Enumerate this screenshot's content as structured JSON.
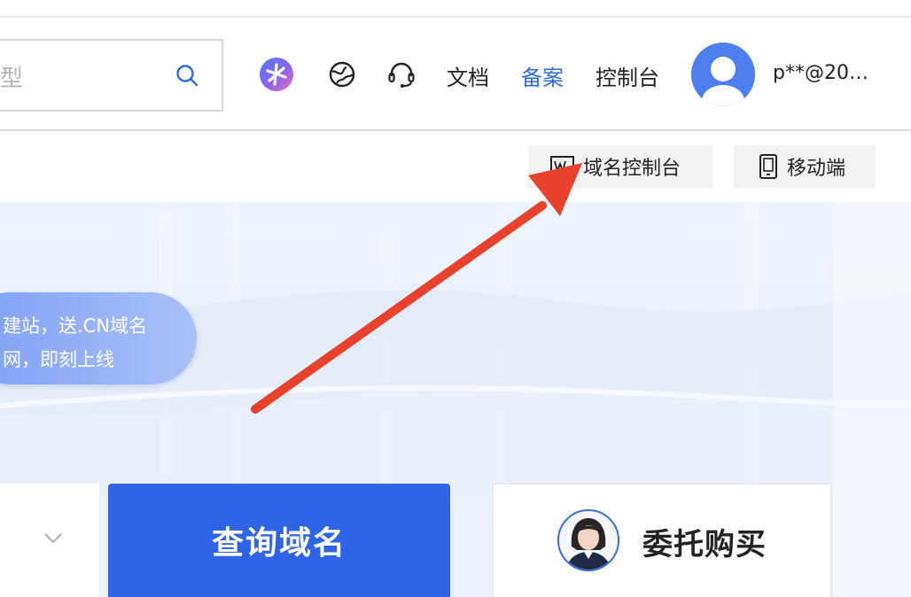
{
  "header": {
    "search": {
      "partial_text": "型"
    },
    "nav": [
      {
        "label": "文档",
        "active": false
      },
      {
        "label": "备案",
        "active": true
      },
      {
        "label": "控制台",
        "active": false
      }
    ],
    "icons": [
      "ai-assistant-icon",
      "globe-icon",
      "headset-icon"
    ],
    "user": {
      "name": "p**@20…"
    }
  },
  "subbar": {
    "domain_console": "域名控制台",
    "mobile": "移动端"
  },
  "hero": {
    "bubble_lines": [
      "建站，送.CN域名",
      "网，即刻上线"
    ]
  },
  "actions": {
    "query": "查询域名",
    "entrust": "委托购买"
  },
  "colors": {
    "accent": "#2f64e6",
    "active_nav": "#2f6bdc",
    "arrow": "#e8412c"
  }
}
